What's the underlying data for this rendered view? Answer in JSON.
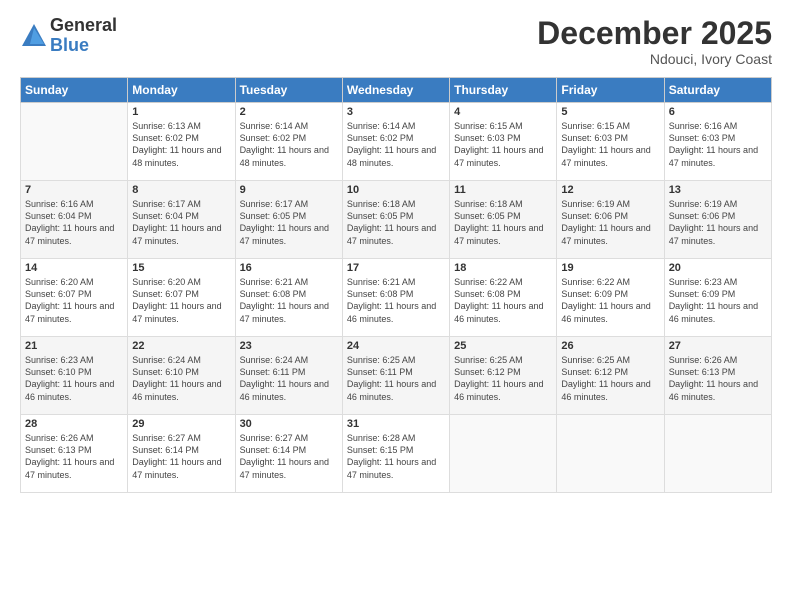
{
  "logo": {
    "general": "General",
    "blue": "Blue"
  },
  "title": "December 2025",
  "location": "Ndouci, Ivory Coast",
  "weekdays": [
    "Sunday",
    "Monday",
    "Tuesday",
    "Wednesday",
    "Thursday",
    "Friday",
    "Saturday"
  ],
  "weeks": [
    [
      {
        "day": "",
        "sunrise": "",
        "sunset": "",
        "daylight": ""
      },
      {
        "day": "1",
        "sunrise": "Sunrise: 6:13 AM",
        "sunset": "Sunset: 6:02 PM",
        "daylight": "Daylight: 11 hours and 48 minutes."
      },
      {
        "day": "2",
        "sunrise": "Sunrise: 6:14 AM",
        "sunset": "Sunset: 6:02 PM",
        "daylight": "Daylight: 11 hours and 48 minutes."
      },
      {
        "day": "3",
        "sunrise": "Sunrise: 6:14 AM",
        "sunset": "Sunset: 6:02 PM",
        "daylight": "Daylight: 11 hours and 48 minutes."
      },
      {
        "day": "4",
        "sunrise": "Sunrise: 6:15 AM",
        "sunset": "Sunset: 6:03 PM",
        "daylight": "Daylight: 11 hours and 47 minutes."
      },
      {
        "day": "5",
        "sunrise": "Sunrise: 6:15 AM",
        "sunset": "Sunset: 6:03 PM",
        "daylight": "Daylight: 11 hours and 47 minutes."
      },
      {
        "day": "6",
        "sunrise": "Sunrise: 6:16 AM",
        "sunset": "Sunset: 6:03 PM",
        "daylight": "Daylight: 11 hours and 47 minutes."
      }
    ],
    [
      {
        "day": "7",
        "sunrise": "Sunrise: 6:16 AM",
        "sunset": "Sunset: 6:04 PM",
        "daylight": "Daylight: 11 hours and 47 minutes."
      },
      {
        "day": "8",
        "sunrise": "Sunrise: 6:17 AM",
        "sunset": "Sunset: 6:04 PM",
        "daylight": "Daylight: 11 hours and 47 minutes."
      },
      {
        "day": "9",
        "sunrise": "Sunrise: 6:17 AM",
        "sunset": "Sunset: 6:05 PM",
        "daylight": "Daylight: 11 hours and 47 minutes."
      },
      {
        "day": "10",
        "sunrise": "Sunrise: 6:18 AM",
        "sunset": "Sunset: 6:05 PM",
        "daylight": "Daylight: 11 hours and 47 minutes."
      },
      {
        "day": "11",
        "sunrise": "Sunrise: 6:18 AM",
        "sunset": "Sunset: 6:05 PM",
        "daylight": "Daylight: 11 hours and 47 minutes."
      },
      {
        "day": "12",
        "sunrise": "Sunrise: 6:19 AM",
        "sunset": "Sunset: 6:06 PM",
        "daylight": "Daylight: 11 hours and 47 minutes."
      },
      {
        "day": "13",
        "sunrise": "Sunrise: 6:19 AM",
        "sunset": "Sunset: 6:06 PM",
        "daylight": "Daylight: 11 hours and 47 minutes."
      }
    ],
    [
      {
        "day": "14",
        "sunrise": "Sunrise: 6:20 AM",
        "sunset": "Sunset: 6:07 PM",
        "daylight": "Daylight: 11 hours and 47 minutes."
      },
      {
        "day": "15",
        "sunrise": "Sunrise: 6:20 AM",
        "sunset": "Sunset: 6:07 PM",
        "daylight": "Daylight: 11 hours and 47 minutes."
      },
      {
        "day": "16",
        "sunrise": "Sunrise: 6:21 AM",
        "sunset": "Sunset: 6:08 PM",
        "daylight": "Daylight: 11 hours and 47 minutes."
      },
      {
        "day": "17",
        "sunrise": "Sunrise: 6:21 AM",
        "sunset": "Sunset: 6:08 PM",
        "daylight": "Daylight: 11 hours and 46 minutes."
      },
      {
        "day": "18",
        "sunrise": "Sunrise: 6:22 AM",
        "sunset": "Sunset: 6:08 PM",
        "daylight": "Daylight: 11 hours and 46 minutes."
      },
      {
        "day": "19",
        "sunrise": "Sunrise: 6:22 AM",
        "sunset": "Sunset: 6:09 PM",
        "daylight": "Daylight: 11 hours and 46 minutes."
      },
      {
        "day": "20",
        "sunrise": "Sunrise: 6:23 AM",
        "sunset": "Sunset: 6:09 PM",
        "daylight": "Daylight: 11 hours and 46 minutes."
      }
    ],
    [
      {
        "day": "21",
        "sunrise": "Sunrise: 6:23 AM",
        "sunset": "Sunset: 6:10 PM",
        "daylight": "Daylight: 11 hours and 46 minutes."
      },
      {
        "day": "22",
        "sunrise": "Sunrise: 6:24 AM",
        "sunset": "Sunset: 6:10 PM",
        "daylight": "Daylight: 11 hours and 46 minutes."
      },
      {
        "day": "23",
        "sunrise": "Sunrise: 6:24 AM",
        "sunset": "Sunset: 6:11 PM",
        "daylight": "Daylight: 11 hours and 46 minutes."
      },
      {
        "day": "24",
        "sunrise": "Sunrise: 6:25 AM",
        "sunset": "Sunset: 6:11 PM",
        "daylight": "Daylight: 11 hours and 46 minutes."
      },
      {
        "day": "25",
        "sunrise": "Sunrise: 6:25 AM",
        "sunset": "Sunset: 6:12 PM",
        "daylight": "Daylight: 11 hours and 46 minutes."
      },
      {
        "day": "26",
        "sunrise": "Sunrise: 6:25 AM",
        "sunset": "Sunset: 6:12 PM",
        "daylight": "Daylight: 11 hours and 46 minutes."
      },
      {
        "day": "27",
        "sunrise": "Sunrise: 6:26 AM",
        "sunset": "Sunset: 6:13 PM",
        "daylight": "Daylight: 11 hours and 46 minutes."
      }
    ],
    [
      {
        "day": "28",
        "sunrise": "Sunrise: 6:26 AM",
        "sunset": "Sunset: 6:13 PM",
        "daylight": "Daylight: 11 hours and 47 minutes."
      },
      {
        "day": "29",
        "sunrise": "Sunrise: 6:27 AM",
        "sunset": "Sunset: 6:14 PM",
        "daylight": "Daylight: 11 hours and 47 minutes."
      },
      {
        "day": "30",
        "sunrise": "Sunrise: 6:27 AM",
        "sunset": "Sunset: 6:14 PM",
        "daylight": "Daylight: 11 hours and 47 minutes."
      },
      {
        "day": "31",
        "sunrise": "Sunrise: 6:28 AM",
        "sunset": "Sunset: 6:15 PM",
        "daylight": "Daylight: 11 hours and 47 minutes."
      },
      {
        "day": "",
        "sunrise": "",
        "sunset": "",
        "daylight": ""
      },
      {
        "day": "",
        "sunrise": "",
        "sunset": "",
        "daylight": ""
      },
      {
        "day": "",
        "sunrise": "",
        "sunset": "",
        "daylight": ""
      }
    ]
  ]
}
